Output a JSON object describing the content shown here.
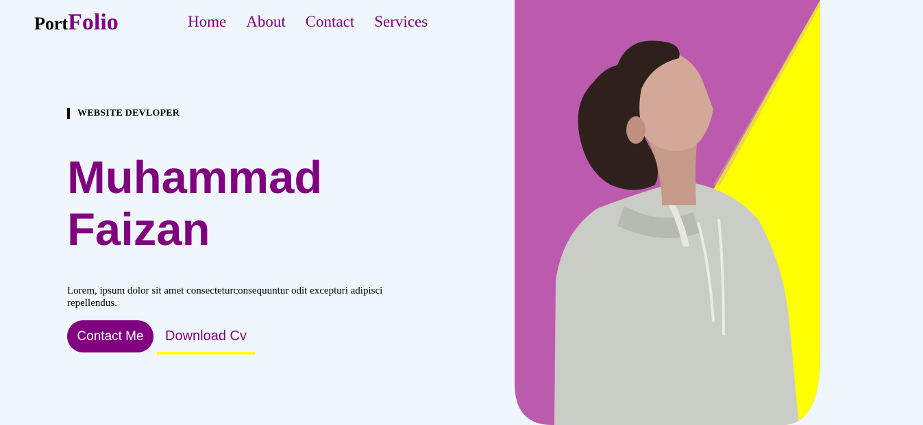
{
  "header": {
    "logo_prefix": "Port",
    "logo_accent": "Folio",
    "nav": [
      {
        "label": "Home"
      },
      {
        "label": "About"
      },
      {
        "label": "Contact"
      },
      {
        "label": "Services"
      }
    ]
  },
  "hero": {
    "tagline": "WEBSITE DEVLOPER",
    "name_line1": "Muhammad",
    "name_line2": "Faizan",
    "description": "Lorem, ipsum dolor sit amet consecteturconsequuntur odit excepturi adipisci repellendus.",
    "contact_button": "Contact Me",
    "download_button": "Download Cv"
  },
  "colors": {
    "brand": "#800080",
    "accent": "#ffff00",
    "panel": "#bc5bae",
    "background": "#eff7fd"
  },
  "image": {
    "subject": "portrait-photo"
  }
}
